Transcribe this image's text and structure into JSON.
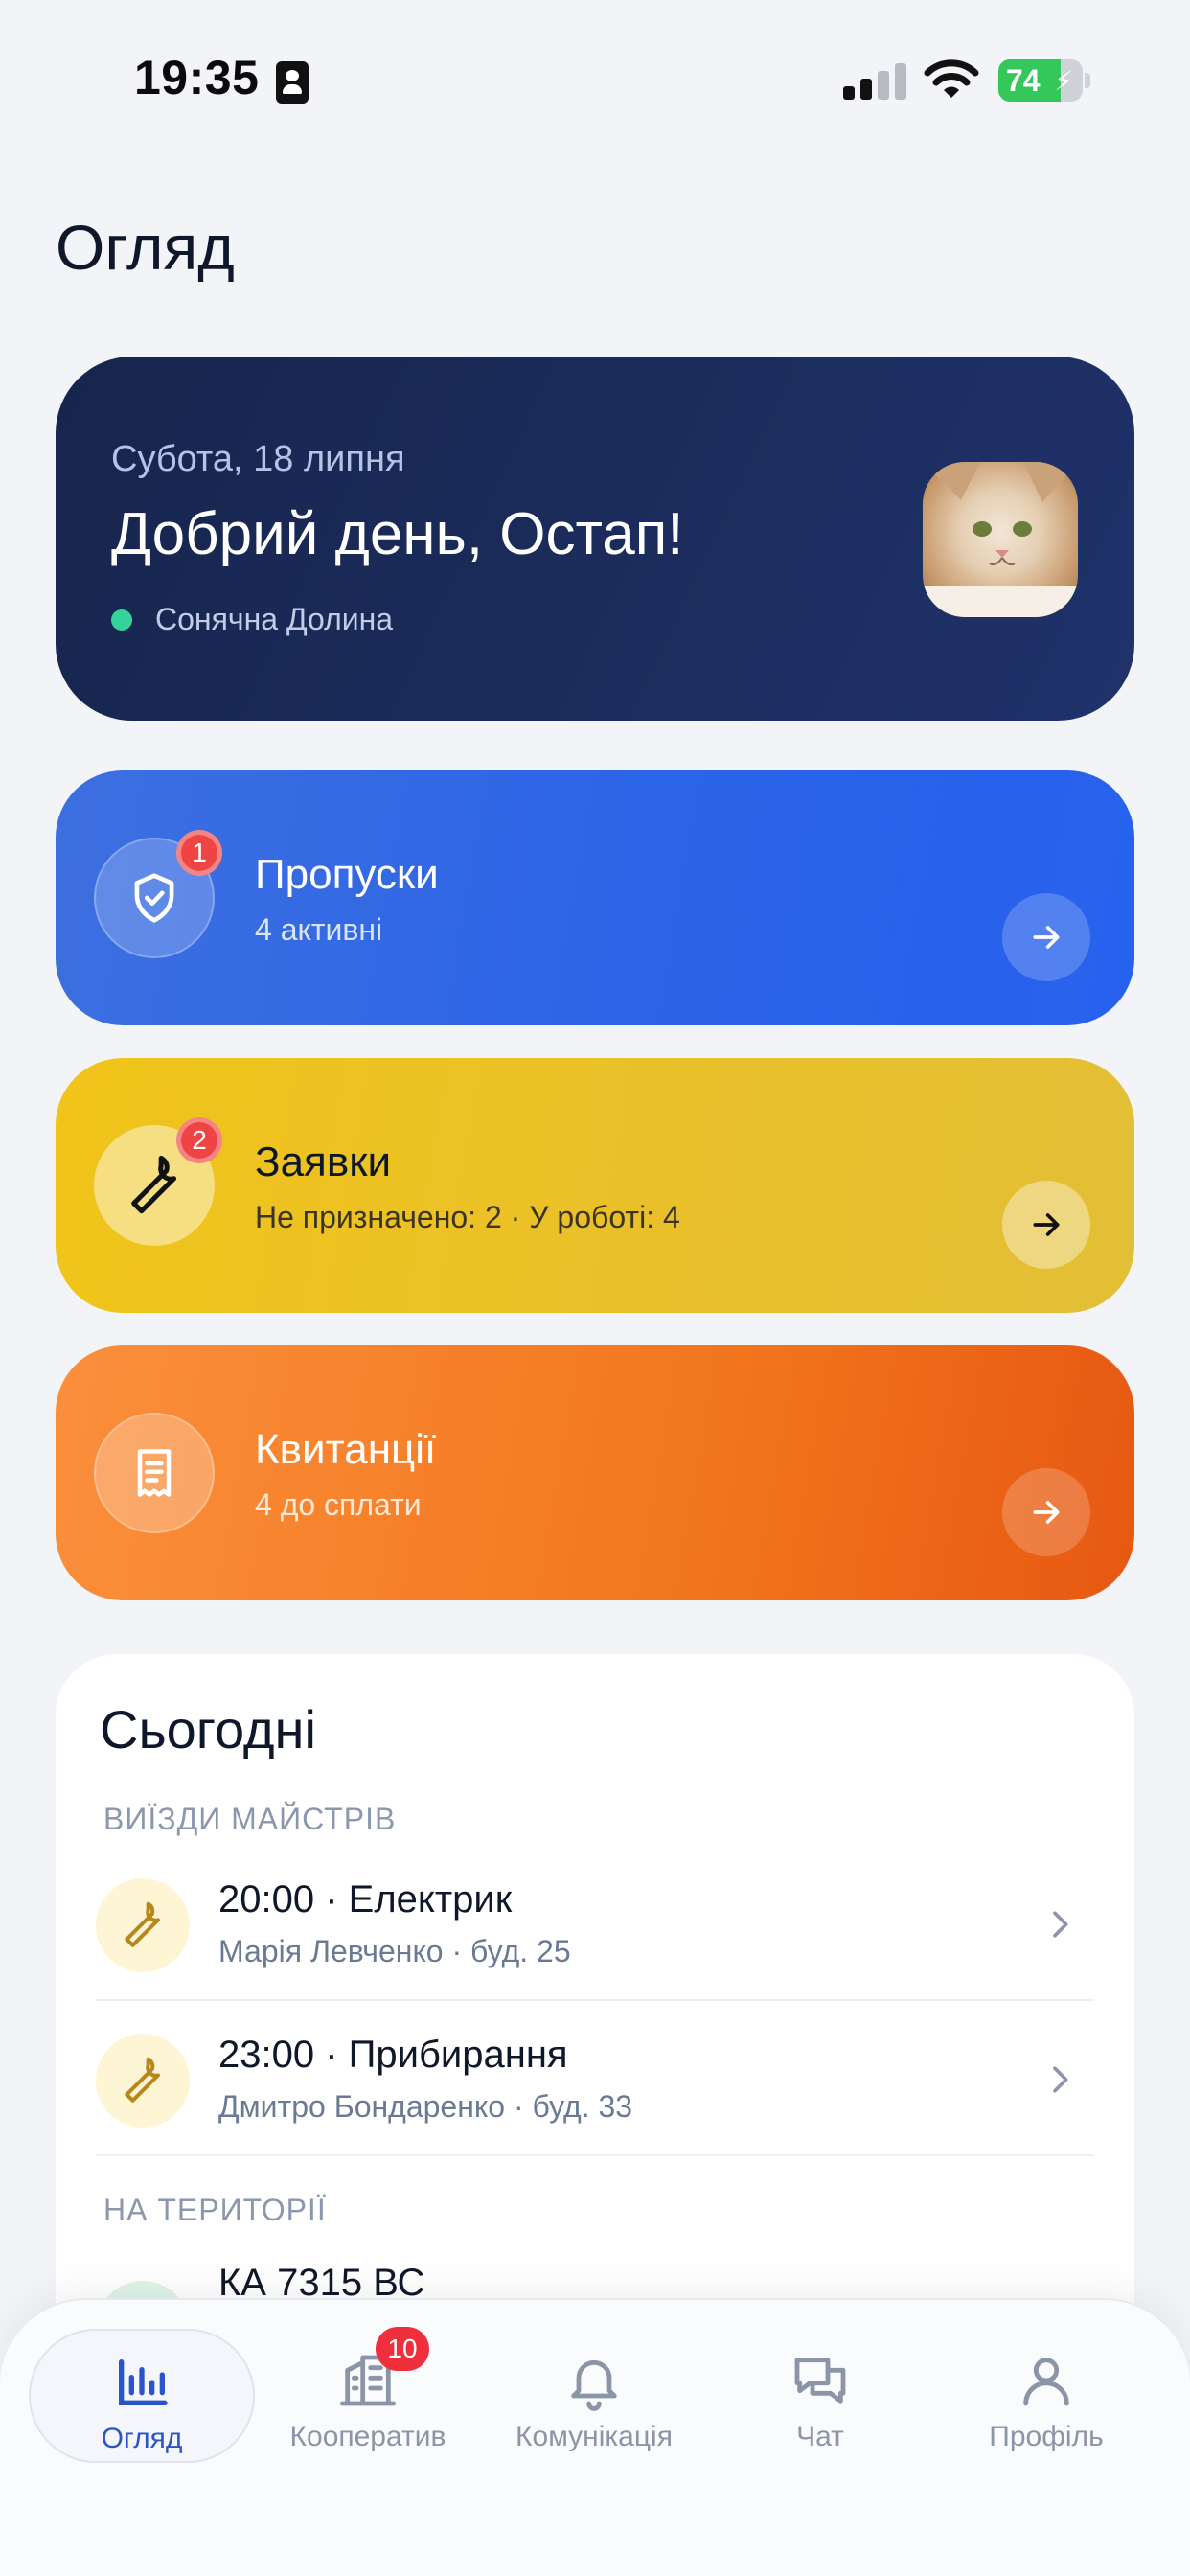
{
  "status_bar": {
    "time": "19:35",
    "battery": "74",
    "battery_level": 0.74,
    "icons": [
      "contact-card-icon",
      "signal-icon",
      "wifi-icon",
      "battery-icon"
    ]
  },
  "page_title": "Огляд",
  "greeting": {
    "date": "Субота, 18 липня",
    "hello": "Добрий день, Остап!",
    "place": "Сонячна Долина",
    "status_color": "#34d399"
  },
  "cards": {
    "passes": {
      "title": "Пропуски",
      "subtitle": "4 активні",
      "badge": "1",
      "icon": "shield-check-icon",
      "color": "#2a63e8"
    },
    "requests": {
      "title": "Заявки",
      "subtitle": "Не призначено: 2 · У роботі: 4",
      "badge": "2",
      "icon": "wrench-icon",
      "color": "#f0c419"
    },
    "receipts": {
      "title": "Квитанції",
      "subtitle": "4 до сплати",
      "icon": "receipt-icon",
      "color": "#f2761d"
    }
  },
  "today": {
    "heading": "Сьогодні",
    "section_visits": "ВИЇЗДИ МАЙСТРІВ",
    "visits": [
      {
        "title": "20:00 · Електрик",
        "meta": "Марія Левченко · буд. 25"
      },
      {
        "title": "23:00 · Прибирання",
        "meta": "Дмитро Бондаренко · буд. 33"
      }
    ],
    "section_territory": "НА ТЕРИТОРІЇ",
    "territory_first": "КА 7315 ВС"
  },
  "tabbar": {
    "tabs": [
      {
        "label": "Огляд",
        "icon": "bar-chart-icon",
        "active": true
      },
      {
        "label": "Кооператив",
        "icon": "building-icon",
        "badge": "10"
      },
      {
        "label": "Комунікація",
        "icon": "bell-icon"
      },
      {
        "label": "Чат",
        "icon": "chat-bubbles-icon"
      },
      {
        "label": "Профіль",
        "icon": "user-icon"
      }
    ],
    "accent": "#2a55c9"
  }
}
